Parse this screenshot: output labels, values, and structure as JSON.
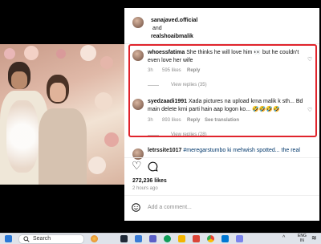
{
  "post": {
    "author": "sanajaved.official",
    "and_text": "and",
    "coauthor": "realshoaibmalik"
  },
  "comments": [
    {
      "user": "whoessfatima",
      "text": "She thinks he will love him 👀 but he couldn't even love her wife",
      "time": "3h",
      "likes": "595 likes",
      "reply": "Reply",
      "view_replies": "View replies (35)"
    },
    {
      "user": "syedzaadi1991",
      "text": "Xada pictures na upload krna malik k sth... Bd main delete krni parti hain aap logon ko... 🤣🤣🤣🤣",
      "time": "3h",
      "likes": "893 likes",
      "reply": "Reply",
      "see_translation": "See translation",
      "view_replies": "View replies (28)"
    }
  ],
  "partial_comment": {
    "user": "letrssite1017",
    "text": "#meregarstumbo ki mehwish spotted... the real"
  },
  "stats": {
    "likes": "272,236 likes",
    "time_ago": "2 hours ago"
  },
  "add_comment": {
    "placeholder": "Add a comment..."
  },
  "taskbar": {
    "search_label": "Search",
    "lang_line1": "ENG",
    "lang_line2": "IN"
  },
  "colors": {
    "highlight_border": "#e0242c",
    "link_blue": "#0095f6"
  }
}
